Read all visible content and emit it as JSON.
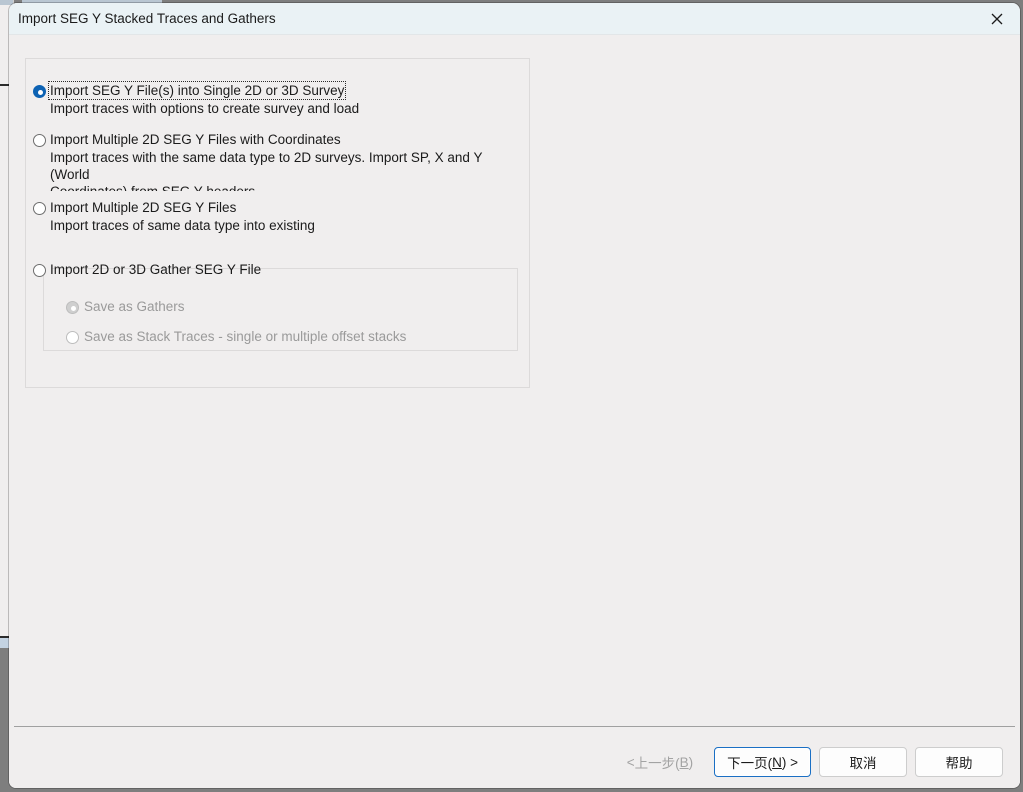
{
  "window": {
    "title": "Import SEG Y Stacked Traces and Gathers",
    "close_icon": "close-icon"
  },
  "options": [
    {
      "id": "single-survey",
      "label": "Import SEG Y File(s) into Single 2D or 3D Survey",
      "description": "Import traces with options to create survey and load",
      "selected": true,
      "focused": true
    },
    {
      "id": "multiple-2d-with-coordinates",
      "label": "Import Multiple 2D SEG Y Files with Coordinates",
      "description": "Import traces with the same data type to 2D surveys. Import SP,  X and Y",
      "description_line2": "(World",
      "description_line3": "Coordinates) from SEG Y headers.",
      "selected": false,
      "focused": false
    },
    {
      "id": "multiple-2d",
      "label": "Import Multiple 2D SEG Y Files",
      "description": "Import traces of same data type into existing",
      "selected": false,
      "focused": false
    },
    {
      "id": "gather-file",
      "label": "Import 2D or 3D Gather SEG Y File",
      "selected": false,
      "focused": false
    }
  ],
  "gather_options": [
    {
      "id": "save-as-gathers",
      "label": "Save as Gathers",
      "selected": true,
      "disabled": true
    },
    {
      "id": "save-as-stack-traces",
      "label": "Save as Stack Traces - single or multiple offset stacks",
      "selected": false,
      "disabled": true
    }
  ],
  "footer": {
    "back": {
      "prefix": "< ",
      "text": "上一步(",
      "mnemonic": "B",
      "suffix": ")",
      "disabled": true
    },
    "next": {
      "text": "下一页(",
      "mnemonic": "N",
      "suffix": ") >",
      "default": true
    },
    "cancel": {
      "label": "取消"
    },
    "help": {
      "label": "帮助"
    }
  },
  "colors": {
    "titlebar": "#eaf2f5",
    "body": "#f0eeee",
    "accent": "#0d62b3",
    "default_button_border": "#1a6fc4",
    "disabled_text": "#9a9a9a"
  }
}
